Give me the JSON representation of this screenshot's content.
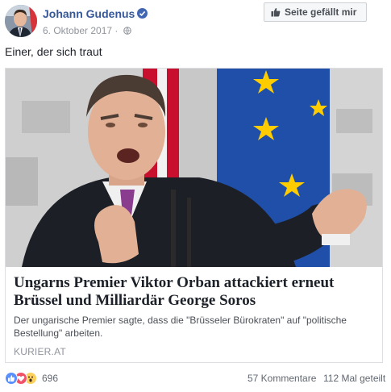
{
  "post": {
    "author": "Johann Gudenus",
    "verified": true,
    "date": "6. Oktober 2017",
    "date_separator": "·",
    "text": "Einer, der sich traut"
  },
  "like_page_button": {
    "label": "Seite gefällt mir",
    "icon": "thumbs-up-icon"
  },
  "link_preview": {
    "title": "Ungarns Premier Viktor Orban attackiert erneut Brüssel und Milliardär George Soros",
    "description": "Der ungarische Premier sagte, dass die \"Brüsseler Bürokraten\" auf \"politische Bestellung\" arbeiten.",
    "domain": "KURIER.AT"
  },
  "engagement": {
    "reactions": [
      "like",
      "love",
      "wow"
    ],
    "reaction_count": "696",
    "comments": "57 Kommentare",
    "shares": "112 Mal geteilt"
  },
  "colors": {
    "link_blue": "#365899",
    "verified_blue": "#4267b2",
    "eu_blue": "#1f4fa8",
    "eu_gold": "#ffcc00"
  }
}
